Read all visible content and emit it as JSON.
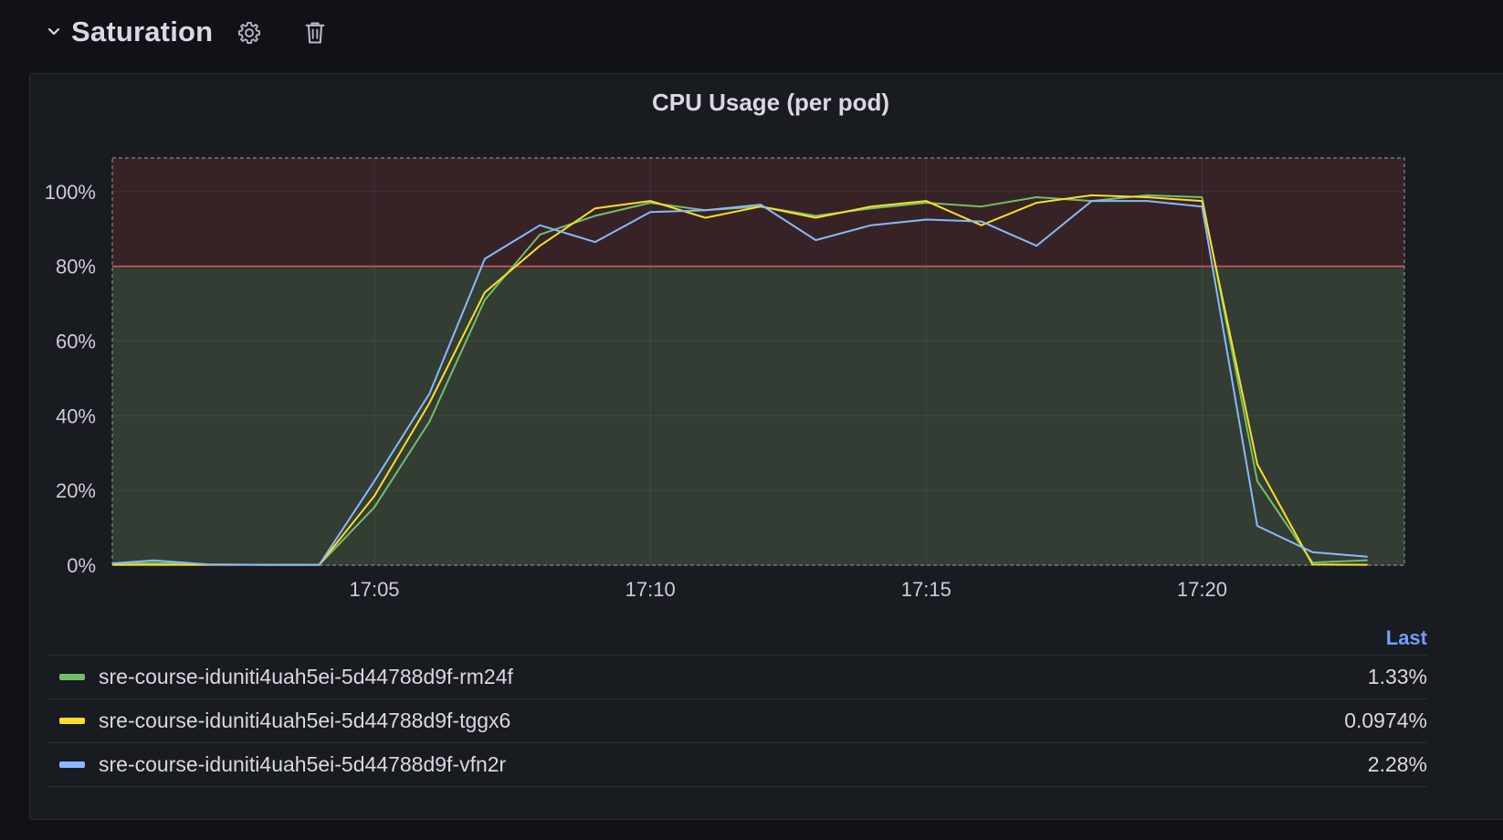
{
  "row": {
    "title": "Saturation",
    "icons": [
      "chevron-down-icon",
      "gear-icon",
      "trash-icon"
    ]
  },
  "panel": {
    "title": "CPU Usage (per pod)"
  },
  "colors": {
    "background": "#111217",
    "panel": "#181b1f",
    "threshold_red": "#e0575f",
    "red_zone": "#372326",
    "green_zone": "#333d33",
    "series_green": "#73bf69",
    "series_yellow": "#fade2a",
    "series_blue": "#8ab8ff",
    "legend_header": "#6e9fff"
  },
  "legend": {
    "header": "Last",
    "items": [
      {
        "name": "sre-course-iduniti4uah5ei-5d44788d9f-rm24f",
        "value": "1.33%",
        "color": "#73bf69"
      },
      {
        "name": "sre-course-iduniti4uah5ei-5d44788d9f-tggx6",
        "value": "0.0974%",
        "color": "#fade2a"
      },
      {
        "name": "sre-course-iduniti4uah5ei-5d44788d9f-vfn2r",
        "value": "2.28%",
        "color": "#8ab8ff"
      }
    ]
  },
  "chart_data": {
    "type": "line",
    "title": "CPU Usage (per pod)",
    "x_unit": "minutes",
    "x": [
      "17:00:15",
      "17:01:00",
      "17:02",
      "17:03",
      "17:04",
      "17:05",
      "17:06",
      "17:07",
      "17:08",
      "17:09",
      "17:10",
      "17:11",
      "17:12",
      "17:13",
      "17:14",
      "17:15",
      "17:16",
      "17:17",
      "17:18",
      "17:19",
      "17:20",
      "17:21",
      "17:22",
      "17:23"
    ],
    "x_ticks": [
      "17:05",
      "17:10",
      "17:15",
      "17:20"
    ],
    "xlim": [
      "17:00:15",
      "17:23:40"
    ],
    "ylim": [
      0,
      109
    ],
    "y_ticks": [
      "0%",
      "20%",
      "40%",
      "60%",
      "80%",
      "100%"
    ],
    "threshold": {
      "value": 80,
      "above_color": "#372326",
      "below_color": "#333d33",
      "line_color": "#e0575f"
    },
    "grid": true,
    "legend_placement": "bottom",
    "series": [
      {
        "name": "sre-course-iduniti4uah5ei-5d44788d9f-rm24f",
        "color": "#73bf69",
        "values": [
          0.3,
          0.6,
          0.2,
          0.1,
          0.1,
          15.5,
          38.5,
          71,
          88.5,
          93.5,
          97,
          95,
          96,
          93.5,
          95.5,
          97,
          96,
          98.5,
          97.5,
          99,
          98.5,
          22.5,
          0.7,
          1.33
        ]
      },
      {
        "name": "sre-course-iduniti4uah5ei-5d44788d9f-tggx6",
        "color": "#fade2a",
        "values": [
          0.1,
          0.1,
          0.1,
          0.1,
          0.1,
          18.5,
          43.5,
          73,
          85.5,
          95.5,
          97.5,
          93,
          96,
          93,
          96,
          97.5,
          91,
          97,
          99,
          98.5,
          97.5,
          27,
          0.2,
          0.0974
        ]
      },
      {
        "name": "sre-course-iduniti4uah5ei-5d44788d9f-vfn2r",
        "color": "#8ab8ff",
        "values": [
          0.5,
          1.3,
          0.2,
          0.1,
          0.1,
          22.5,
          46,
          82,
          91,
          86.5,
          94.5,
          95,
          96.5,
          87,
          91,
          92.5,
          92,
          85.5,
          97.5,
          97.5,
          96,
          10.5,
          3.5,
          2.28
        ]
      }
    ]
  }
}
